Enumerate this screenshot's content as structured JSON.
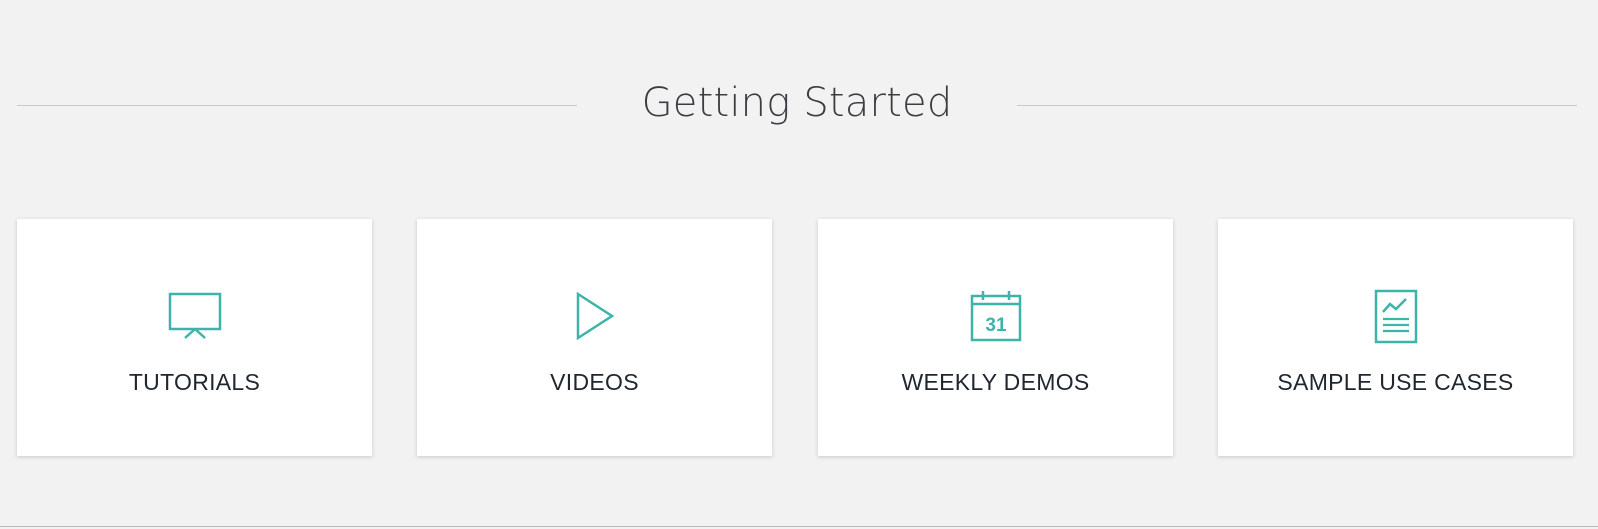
{
  "section": {
    "title": "Getting Started"
  },
  "accent_color": "#3cb4a9",
  "cards": [
    {
      "label": "TUTORIALS",
      "icon": "presentation-board-icon"
    },
    {
      "label": "VIDEOS",
      "icon": "play-icon"
    },
    {
      "label": "WEEKLY DEMOS",
      "icon": "calendar-icon",
      "icon_text": "31"
    },
    {
      "label": "SAMPLE USE CASES",
      "icon": "report-document-icon"
    }
  ]
}
